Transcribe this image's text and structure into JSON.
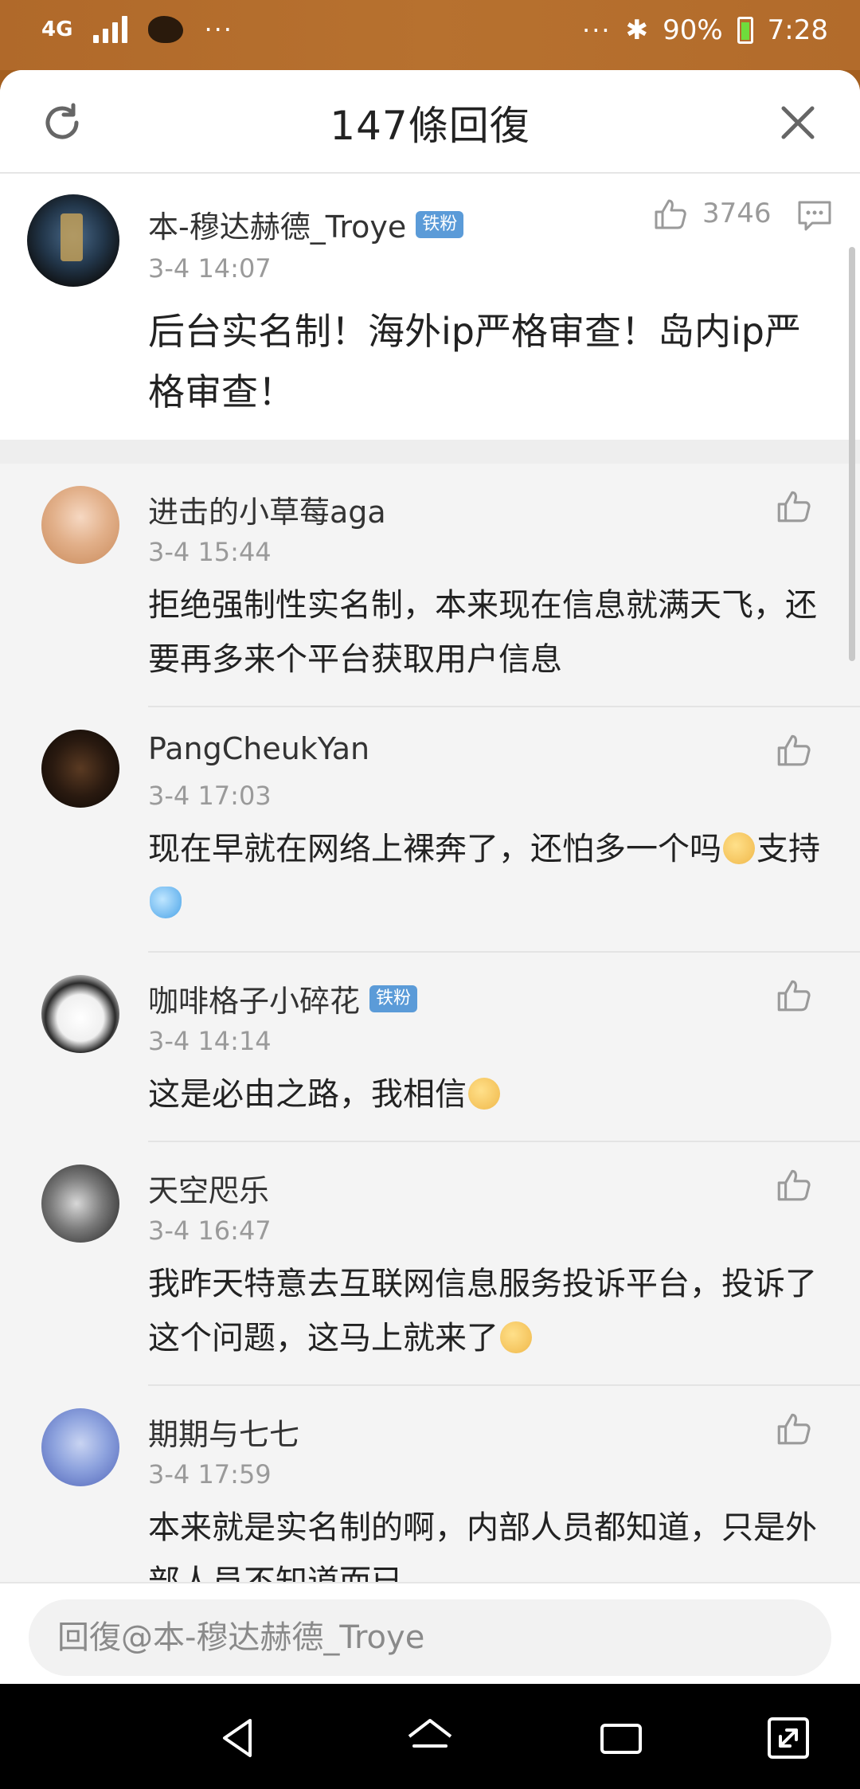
{
  "status_bar": {
    "network": "4G",
    "dots_left": "···",
    "dots_right": "···",
    "battery": "90%",
    "time": "7:28"
  },
  "header": {
    "title": "147條回復",
    "refresh_icon": "refresh-icon",
    "close_icon": "close-icon"
  },
  "top_comment": {
    "name": "本-穆达赫德_Troye",
    "badge": "铁粉",
    "time": "3-4 14:07",
    "likes": "3746",
    "text": "后台实名制！海外ip严格审查！岛内ip严格审查！"
  },
  "replies": [
    {
      "name": "进击的小草莓aga",
      "badge": "",
      "time": "3-4 15:44",
      "text": "拒绝强制性实名制，本来现在信息就满天飞，还要再多来个平台获取用户信息",
      "emoji": ""
    },
    {
      "name": "PangCheukYan",
      "badge": "",
      "time": "3-4 17:03",
      "text": "现在早就在网络上裸奔了，还怕多一个吗",
      "text2": "支持",
      "emoji": "doge"
    },
    {
      "name": "咖啡格子小碎花",
      "badge": "铁粉",
      "time": "3-4 14:14",
      "text": "这是必由之路，我相信",
      "emoji": "doge"
    },
    {
      "name": "天空咫乐",
      "badge": "",
      "time": "3-4 16:47",
      "text": "我昨天特意去互联网信息服务投诉平台，投诉了这个问题，这马上就来了",
      "emoji": "doge"
    },
    {
      "name": "期期与七七",
      "badge": "",
      "time": "3-4 17:59",
      "text": "本来就是实名制的啊，内部人员都知道，只是外部人员不知道而已",
      "emoji": ""
    }
  ],
  "reply_bar": {
    "placeholder": "回復@本-穆达赫德_Troye"
  },
  "colors": {
    "accent_badge": "#5b9bd8",
    "status_bar_bg": "#b0692a",
    "text_primary": "#222222",
    "text_secondary": "#9a9a9a"
  }
}
